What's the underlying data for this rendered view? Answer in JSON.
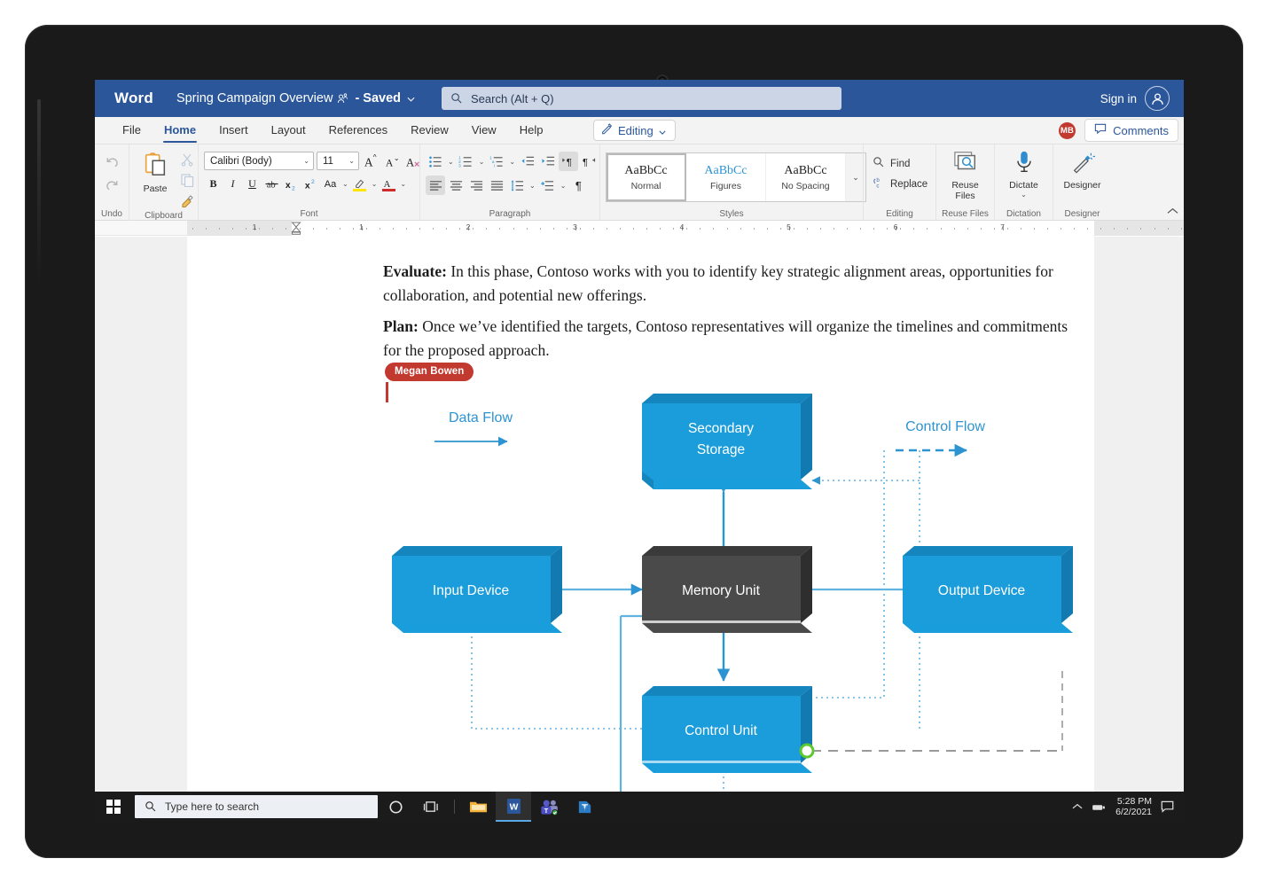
{
  "app": {
    "logo": "Word",
    "doc_title": "Spring Campaign Overview",
    "saved_state": "- Saved",
    "people_icon": "people-share-icon",
    "title_chevron": "chevron-down-icon",
    "accent_color": "#2b579a",
    "sign_in": "Sign in",
    "avatar_icon": "person-avatar-icon"
  },
  "search": {
    "placeholder": "Search (Alt + Q)",
    "icon": "search-icon"
  },
  "tabs": [
    {
      "label": "File",
      "active": false
    },
    {
      "label": "Home",
      "active": true
    },
    {
      "label": "Insert",
      "active": false
    },
    {
      "label": "Layout",
      "active": false
    },
    {
      "label": "References",
      "active": false
    },
    {
      "label": "Review",
      "active": false
    },
    {
      "label": "View",
      "active": false
    },
    {
      "label": "Help",
      "active": false
    }
  ],
  "editing_button": {
    "label": "Editing",
    "icon": "pencil-icon",
    "chevron": "chevron-down-icon"
  },
  "presence": {
    "initials": "MB",
    "color": "#c2392f"
  },
  "comments_button": {
    "label": "Comments",
    "icon": "comment-bubble-icon"
  },
  "ribbon": {
    "groups": [
      {
        "name": "Undo",
        "label": "Undo",
        "items": [
          "undo-arrow-icon",
          "redo-arrow-icon"
        ]
      },
      {
        "name": "Clipboard",
        "label": "Clipboard",
        "paste_label": "Paste",
        "items": [
          "paste-clipboard-icon",
          "cut-scissors-icon",
          "copy-icon",
          "format-painter-icon"
        ]
      },
      {
        "name": "Font",
        "label": "Font",
        "font_name": "Calibri (Body)",
        "font_size": "11",
        "items": [
          "grow-font-icon",
          "shrink-font-icon",
          "clear-formatting-icon",
          "bold-icon",
          "italic-icon",
          "underline-icon",
          "strikethrough-icon",
          "subscript-icon",
          "superscript-icon",
          "change-case-icon",
          "text-highlight-icon",
          "font-color-icon"
        ],
        "highlight_color": "#ffe600",
        "font_color": "#cf2b2b"
      },
      {
        "name": "Paragraph",
        "label": "Paragraph",
        "items": [
          "bullet-list-icon",
          "numbered-list-icon",
          "multilevel-list-icon",
          "decrease-indent-icon",
          "increase-indent-icon",
          "ltr-text-icon",
          "rtl-text-icon",
          "align-left-icon",
          "align-center-icon",
          "align-right-icon",
          "justify-icon",
          "line-spacing-icon",
          "shading-icon",
          "show-marks-icon"
        ]
      },
      {
        "name": "Styles",
        "label": "Styles",
        "gallery": [
          {
            "sample": "AaBbCc",
            "name": "Normal",
            "selected": true,
            "blue": false
          },
          {
            "sample": "AaBbCc",
            "name": "Figures",
            "selected": false,
            "blue": true
          },
          {
            "sample": "AaBbCc",
            "name": "No Spacing",
            "selected": false,
            "blue": false
          }
        ],
        "more_icon": "chevron-down-icon"
      },
      {
        "name": "Editing",
        "label": "Editing",
        "find_label": "Find",
        "replace_label": "Replace",
        "items": [
          "search-icon",
          "replace-icon"
        ]
      },
      {
        "name": "Reuse Files",
        "label": "Reuse Files",
        "btn_label": "Reuse\nFiles",
        "icon": "reuse-files-icon"
      },
      {
        "name": "Dictation",
        "label": "Dictation",
        "btn_label": "Dictate",
        "icon": "microphone-icon",
        "chevron": "chevron-down-icon"
      },
      {
        "name": "Designer",
        "label": "Designer",
        "btn_label": "Designer",
        "icon": "designer-wand-icon"
      }
    ],
    "collapse_icon": "chevron-up-icon"
  },
  "ruler": {
    "numbers": [
      "1",
      "1",
      "2",
      "3",
      "4",
      "5",
      "6",
      "7"
    ],
    "indent_marker": "indent-marker-icon"
  },
  "document": {
    "paragraphs": [
      {
        "lead": "Evaluate:",
        "body": " In this phase, Contoso works with you to identify key strategic alignment areas, opportunities for collaboration, and potential new offerings."
      },
      {
        "lead": "Plan:",
        "body": " Once we’ve identified the targets, Contoso representatives will organize the timelines and commitments for the proposed approach."
      }
    ],
    "collaborator": {
      "name": "Megan Bowen",
      "color": "#c2392f"
    }
  },
  "diagram": {
    "type": "block-diagram",
    "legend": [
      {
        "label": "Data Flow",
        "style": "solid",
        "color": "#2e93d1"
      },
      {
        "label": "Control Flow",
        "style": "dashed",
        "color": "#2e93d1"
      }
    ],
    "nodes": [
      {
        "id": "secondary-storage",
        "label": "Secondary Storage",
        "fill": "#1b9ddb",
        "selected": false
      },
      {
        "id": "input-device",
        "label": "Input Device",
        "fill": "#1b9ddb",
        "selected": false
      },
      {
        "id": "memory-unit",
        "label": "Memory Unit",
        "fill": "#4a4a4a",
        "selected": true
      },
      {
        "id": "output-device",
        "label": "Output Device",
        "fill": "#1b9ddb",
        "selected": false
      },
      {
        "id": "control-unit",
        "label": "Control Unit",
        "fill": "#1b9ddb",
        "selected": false
      }
    ],
    "connection_handle": {
      "name": "connection-point-handle",
      "color": "#5ec92e"
    },
    "dragging_connector": {
      "style": "dashed",
      "color": "#9a9a9a"
    }
  },
  "taskbar": {
    "start_icon": "windows-start-icon",
    "search_placeholder": "Type here to search",
    "search_icon": "search-icon",
    "items": [
      {
        "name": "cortana-icon",
        "active": false
      },
      {
        "name": "task-view-icon",
        "active": false
      },
      {
        "name": "file-explorer-icon",
        "active": false
      },
      {
        "name": "word-app-icon",
        "active": true
      },
      {
        "name": "teams-app-icon",
        "active": false,
        "badge": true
      },
      {
        "name": "visio-app-icon",
        "active": false
      }
    ],
    "tray": {
      "chevron": "chevron-up-icon",
      "network_icon": "network-icon",
      "time": "5:28 PM",
      "date": "6/2/2021",
      "action_center_icon": "notification-icon"
    }
  }
}
